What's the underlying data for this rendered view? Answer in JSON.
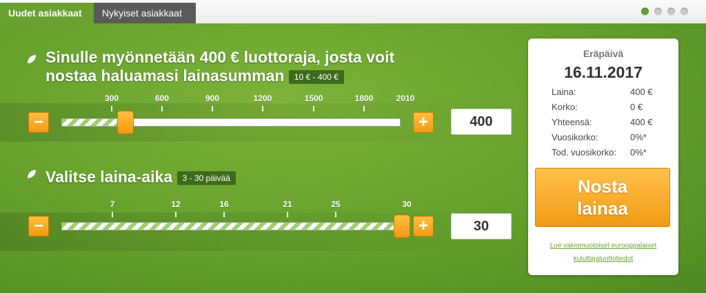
{
  "tabs": [
    {
      "label": "Uudet asiakkaat",
      "active": true
    },
    {
      "label": "Nykyiset asiakkaat",
      "active": false
    }
  ],
  "carousel": {
    "count": 4,
    "active_index": 0
  },
  "amount": {
    "title_line1": "Sinulle myönnetään 400 € luottoraja, josta voit",
    "title_line2": "nostaa haluamasi lainasumman",
    "range_badge": "10 € - 400 €",
    "ticks": [
      "300",
      "600",
      "900",
      "1200",
      "1500",
      "1800",
      "2010"
    ],
    "value": "400",
    "slider_fraction": 0.19
  },
  "period": {
    "title": "Valitse laina-aika",
    "range_badge": "3 - 30 päivää",
    "ticks": [
      "7",
      "12",
      "16",
      "21",
      "25",
      "30"
    ],
    "value": "30",
    "slider_fraction": 1.0
  },
  "summary": {
    "due_label": "Eräpäivä",
    "due_date": "16.11.2017",
    "rows": [
      {
        "label": "Laina:",
        "value": "400 €"
      },
      {
        "label": "Korko:",
        "value": "0 €"
      },
      {
        "label": "Yhteensä:",
        "value": "400 €"
      },
      {
        "label": "Vuosikorko:",
        "value": "0%*"
      },
      {
        "label": "Tod. vuosikorko:",
        "value": "0%*"
      }
    ],
    "cta_line1": "Nosta",
    "cta_line2": "lainaa",
    "link_line1": "Lue vakiomuotoiset eurooppalaiset",
    "link_line2": "kuluttajaluottotiedot"
  },
  "colors": {
    "accent": "#6aa131",
    "button": "#f5a623"
  }
}
